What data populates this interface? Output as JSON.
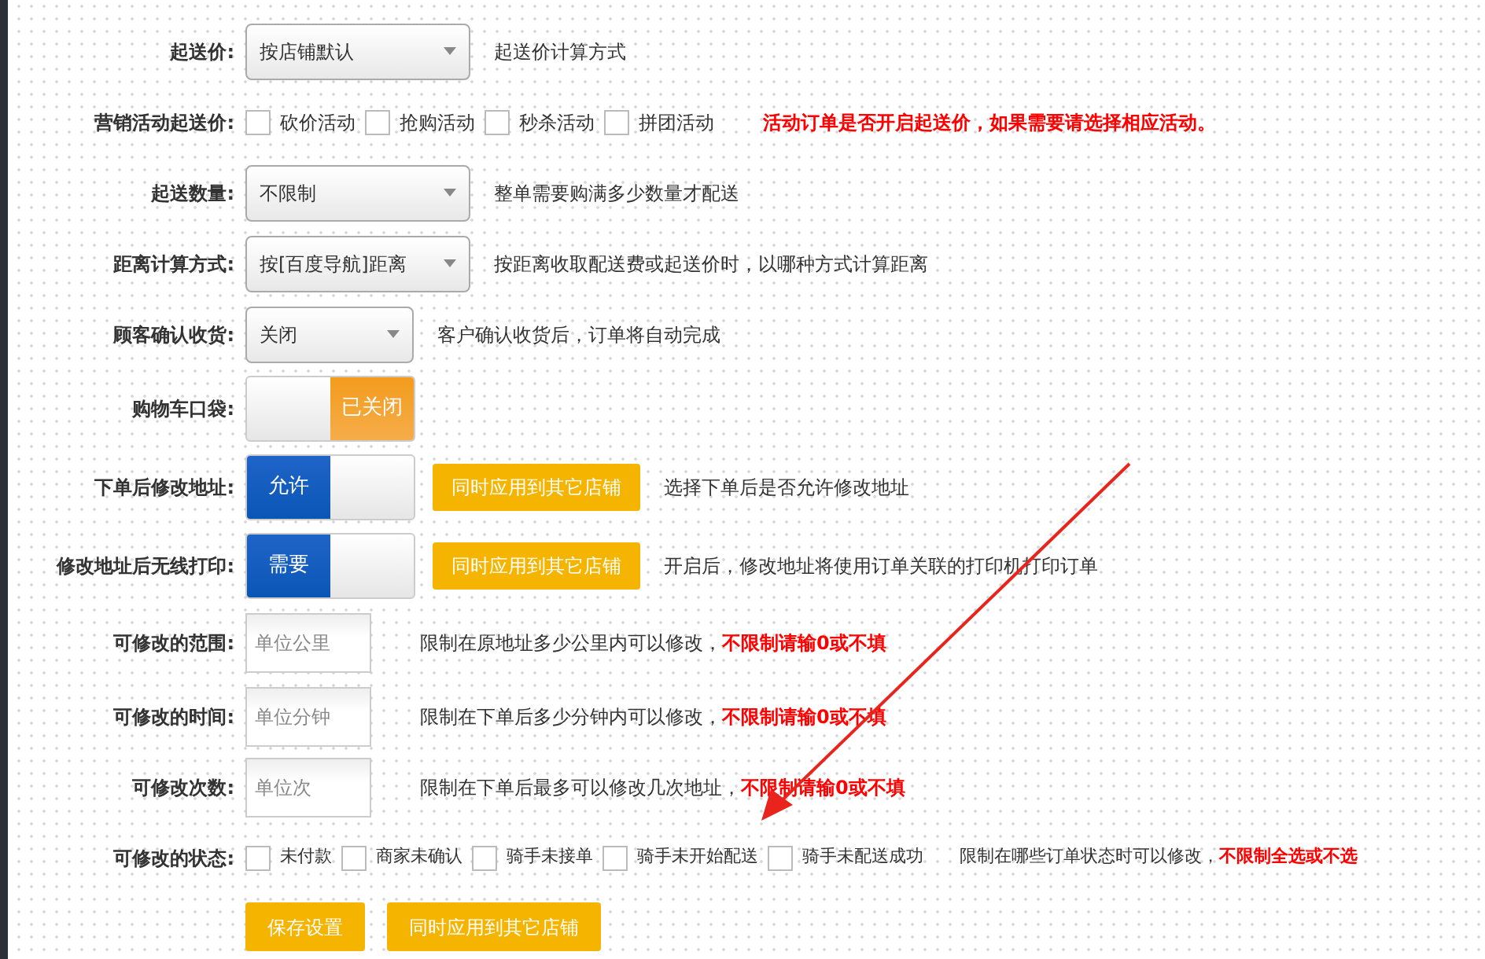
{
  "rows": [
    {
      "kind": "select",
      "label": "起送价:",
      "value": "按店铺默认",
      "hint": "起送价计算方式"
    },
    {
      "kind": "checks",
      "label": "营销活动起送价:",
      "options": [
        {
          "label": "砍价活动",
          "checked": false
        },
        {
          "label": "抢购活动",
          "checked": false
        },
        {
          "label": "秒杀活动",
          "checked": false
        },
        {
          "label": "拼团活动",
          "checked": false
        }
      ],
      "warning": "活动订单是否开启起送价，如果需要请选择相应活动。"
    },
    {
      "kind": "select",
      "label": "起送数量:",
      "value": "不限制",
      "hint": "整单需要购满多少数量才配送"
    },
    {
      "kind": "select",
      "label": "距离计算方式:",
      "value": "按[百度导航]距离",
      "hint": "按距离收取配送费或起送价时，以哪种方式计算距离"
    },
    {
      "kind": "short-select",
      "label": "顾客确认收货:",
      "value": "关闭",
      "hint": "客户确认收货后，订单将自动完成"
    },
    {
      "kind": "toggle",
      "label": "购物车口袋:",
      "on": false,
      "state_text": "已关闭"
    },
    {
      "kind": "toggle",
      "label": "下单后修改地址:",
      "on": true,
      "state_text": "允许",
      "apply": "同时应用到其它店铺",
      "hint": "选择下单后是否允许修改地址"
    },
    {
      "kind": "toggle",
      "label": "修改地址后无线打印:",
      "on": true,
      "state_text": "需要",
      "apply": "同时应用到其它店铺",
      "hint": "开启后，修改地址将使用订单关联的打印机打印订单"
    },
    {
      "kind": "input",
      "label": "可修改的范围:",
      "placeholder": "单位公里",
      "hint": "限制在原地址多少公里内可以修改，",
      "warning": "不限制请输0或不填"
    },
    {
      "kind": "input",
      "label": "可修改的时间:",
      "placeholder": "单位分钟",
      "hint": "限制在下单后多少分钟内可以修改，",
      "warning": "不限制请输0或不填"
    },
    {
      "kind": "input",
      "label": "可修改次数:",
      "placeholder": "单位次",
      "hint": "限制在下单后最多可以修改几次地址，",
      "warning": "不限制请输0或不填"
    },
    {
      "kind": "checks",
      "label": "可修改的状态:",
      "options": [
        {
          "label": "未付款",
          "checked": false
        },
        {
          "label": "商家未确认",
          "checked": false
        },
        {
          "label": "骑手未接单",
          "checked": false
        },
        {
          "label": "骑手未开始配送",
          "checked": false
        },
        {
          "label": "骑手未配送成功",
          "checked": false
        }
      ],
      "hint": "限制在哪些订单状态时可以修改，",
      "warning": "不限制全选或不选"
    },
    {
      "kind": "buttons",
      "buttons": [
        "保存设置",
        "同时应用到其它店铺"
      ]
    }
  ]
}
